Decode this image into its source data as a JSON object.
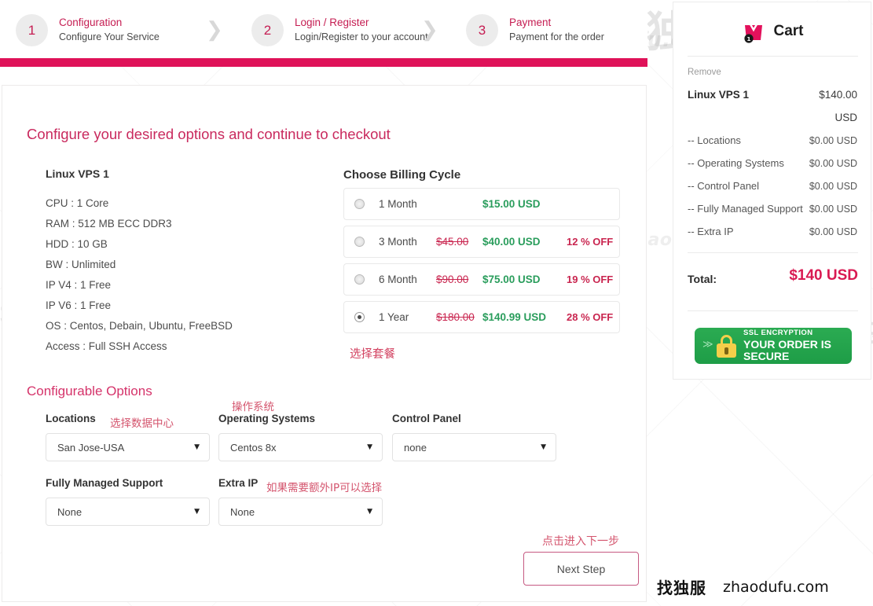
{
  "steps": [
    {
      "num": "1",
      "title": "Configuration",
      "sub": "Configure Your Service"
    },
    {
      "num": "2",
      "title": "Login / Register",
      "sub": "Login/Register to your account"
    },
    {
      "num": "3",
      "title": "Payment",
      "sub": "Payment for the order"
    }
  ],
  "main": {
    "headline": "Configure your desired options and continue to checkout",
    "product_name": "Linux VPS 1",
    "specs": [
      "CPU : 1 Core",
      "RAM : 512 MB ECC DDR3",
      "HDD : 10 GB",
      "BW : Unlimited",
      "IP V4 : 1 Free",
      "IP V6 : 1 Free",
      "OS : Centos, Debain, Ubuntu, FreeBSD",
      "Access : Full SSH Access"
    ],
    "billing_title": "Choose Billing Cycle",
    "cycles": [
      {
        "term": "1 Month",
        "old": "",
        "price": "$15.00 USD",
        "off": "",
        "selected": false
      },
      {
        "term": "3 Month",
        "old": "$45.00",
        "price": "$40.00 USD",
        "off": "12 % OFF",
        "selected": false
      },
      {
        "term": "6 Month",
        "old": "$90.00",
        "price": "$75.00 USD",
        "off": "19 % OFF",
        "selected": false
      },
      {
        "term": "1 Year",
        "old": "$180.00",
        "price": "$140.99 USD",
        "off": "28 % OFF",
        "selected": true
      }
    ],
    "cycle_note": "选择套餐",
    "config_title": "Configurable Options",
    "fields": [
      {
        "label": "Locations",
        "value": "San Jose-USA",
        "note": "选择数据中心"
      },
      {
        "label": "Operating Systems",
        "value": "Centos 8x",
        "note": "操作系统"
      },
      {
        "label": "Control Panel",
        "value": "none",
        "note": ""
      },
      {
        "label": "Fully Managed Support",
        "value": "None",
        "note": ""
      },
      {
        "label": "Extra IP",
        "value": "None",
        "note": "如果需要额外IP可以选择"
      }
    ],
    "next_note": "点击进入下一步",
    "next_label": "Next Step"
  },
  "cart": {
    "title": "Cart",
    "badge": "1",
    "remove_label": "Remove",
    "item_name": "Linux VPS 1",
    "item_price": "$140.00",
    "item_currency": "USD",
    "sub_items": [
      {
        "label": "-- Locations",
        "value": "$0.00 USD"
      },
      {
        "label": "-- Operating Systems",
        "value": "$0.00 USD"
      },
      {
        "label": "-- Control Panel",
        "value": "$0.00 USD"
      },
      {
        "label": "-- Fully Managed Support",
        "value": "$0.00 USD"
      },
      {
        "label": "-- Extra IP",
        "value": "$0.00 USD"
      }
    ],
    "total_label": "Total:",
    "total_value": "$140 USD",
    "ssl_line1": "SSL ENCRYPTION",
    "ssl_line2": "YOUR ORDER  IS SECURE"
  },
  "brand": {
    "cjk": "找独服",
    "domain": "zhaodufu.com"
  },
  "watermarks": {
    "domain": "zhaodufu.com",
    "cjk": "找独服"
  },
  "colors": {
    "accent": "#df1259",
    "accent_text": "#c51d52",
    "price_green": "#2a9d5c",
    "strike_red": "#c9254f",
    "ssl_green": "#1e9d47"
  }
}
